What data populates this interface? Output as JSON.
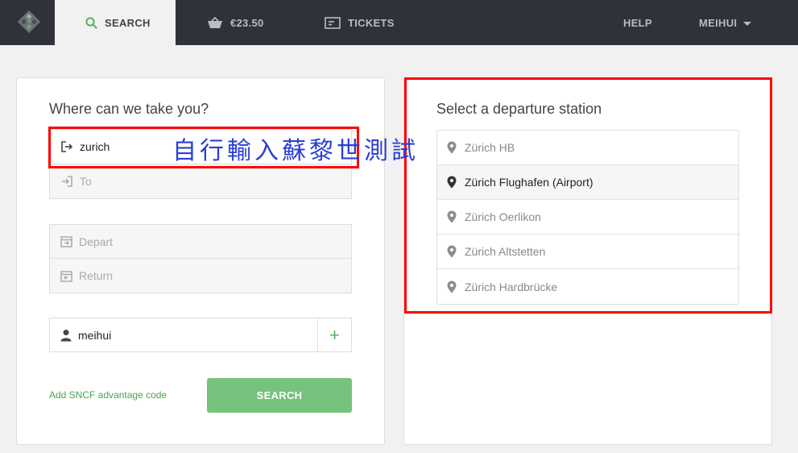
{
  "nav": {
    "search_label": "SEARCH",
    "basket_label": "€23.50",
    "tickets_label": "TICKETS",
    "help_label": "HELP",
    "user_label": "MEIHUI"
  },
  "search_form": {
    "title": "Where can we take you?",
    "from_value": "zurich",
    "to_placeholder": "To",
    "depart_placeholder": "Depart",
    "return_placeholder": "Return",
    "passenger_value": "meihui",
    "add_passenger_label": "+",
    "advantage_link": "Add SNCF advantage code",
    "search_button": "SEARCH"
  },
  "overlay_annotation": "自行輸入蘇黎世測試",
  "stations_panel": {
    "title": "Select a departure station",
    "stations": [
      {
        "name": "Zürich HB",
        "selected": false
      },
      {
        "name": "Zürich Flughafen (Airport)",
        "selected": true
      },
      {
        "name": "Zürich Oerlikon",
        "selected": false
      },
      {
        "name": "Zürich Altstetten",
        "selected": false
      },
      {
        "name": "Zürich Hardbrücke",
        "selected": false
      }
    ]
  },
  "colors": {
    "topbar": "#2f3238",
    "accent_green": "#77c27d",
    "annotation_red": "#ff0000",
    "annotation_blue": "#2a3fd8"
  }
}
